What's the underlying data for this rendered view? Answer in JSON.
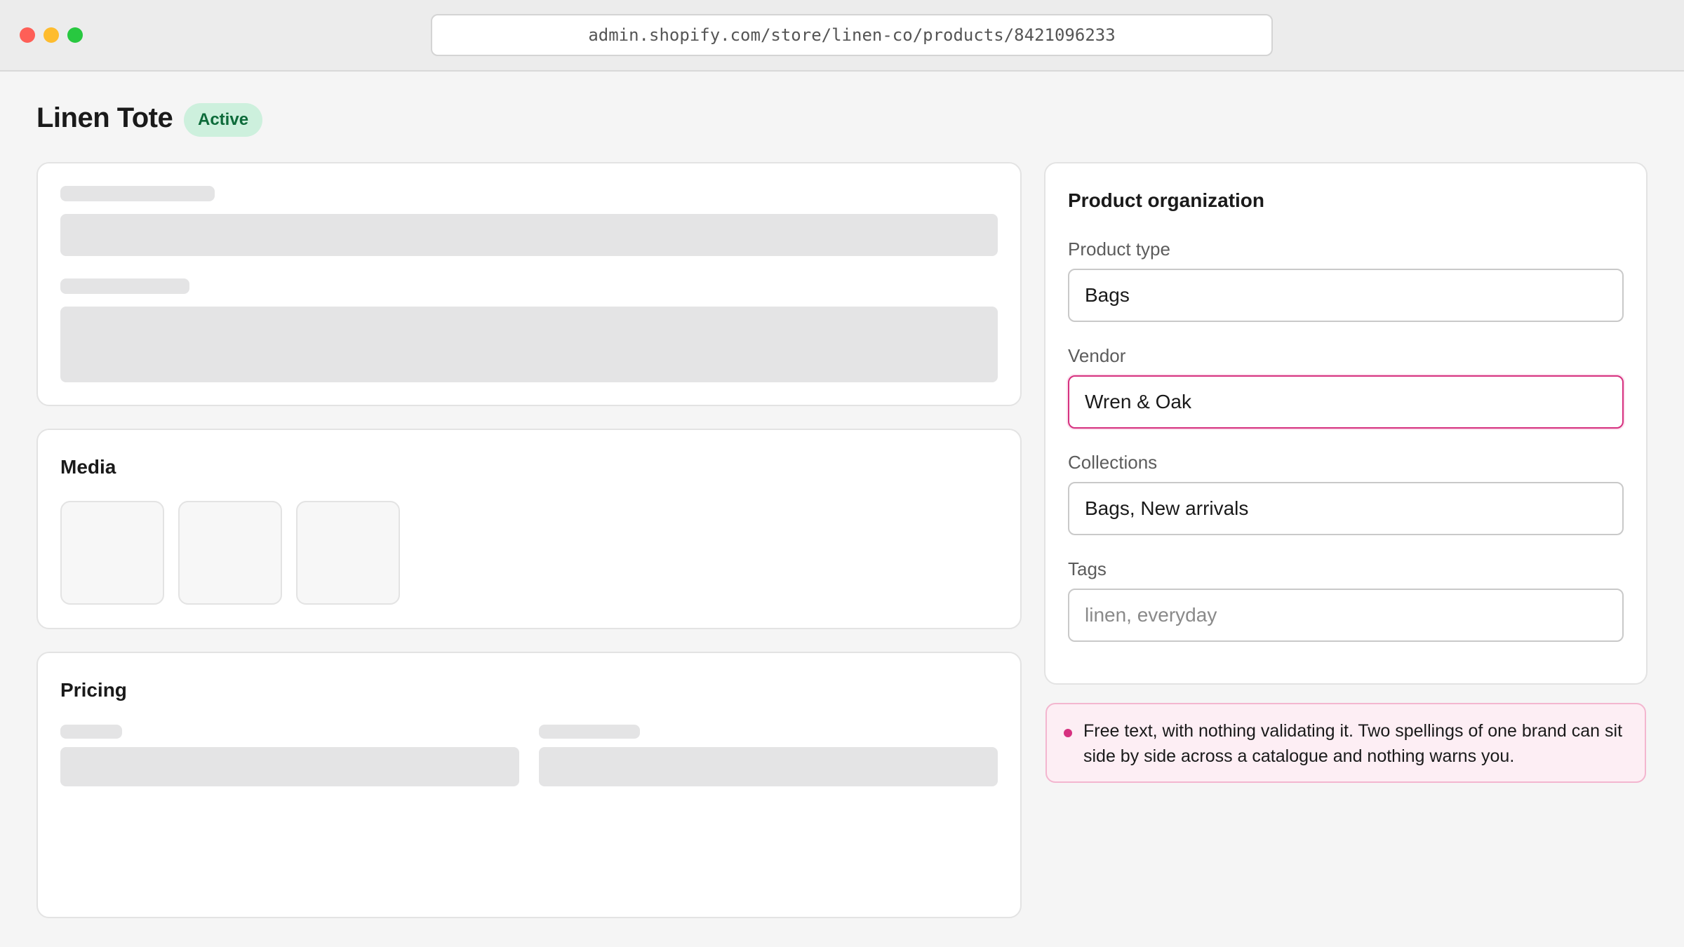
{
  "browser": {
    "url": "admin.shopify.com/store/linen-co/products/8421096233"
  },
  "product": {
    "title": "Linen Tote",
    "status": "Active"
  },
  "media": {
    "title": "Media"
  },
  "pricing": {
    "title": "Pricing"
  },
  "organization": {
    "title": "Product organization",
    "product_type": {
      "label": "Product type",
      "value": "Bags"
    },
    "vendor": {
      "label": "Vendor",
      "value": "Wren & Oak"
    },
    "collections": {
      "label": "Collections",
      "value": "Bags, New arrivals"
    },
    "tags": {
      "label": "Tags",
      "placeholder": "linen, everyday"
    }
  },
  "note": {
    "text": "Free text, with nothing validating it. Two spellings of one brand can sit side by side across a catalogue and nothing warns you."
  },
  "colors": {
    "accent_error": "#d6317f",
    "status_bg": "#cdf0dd",
    "status_text": "#0d6b3a"
  }
}
